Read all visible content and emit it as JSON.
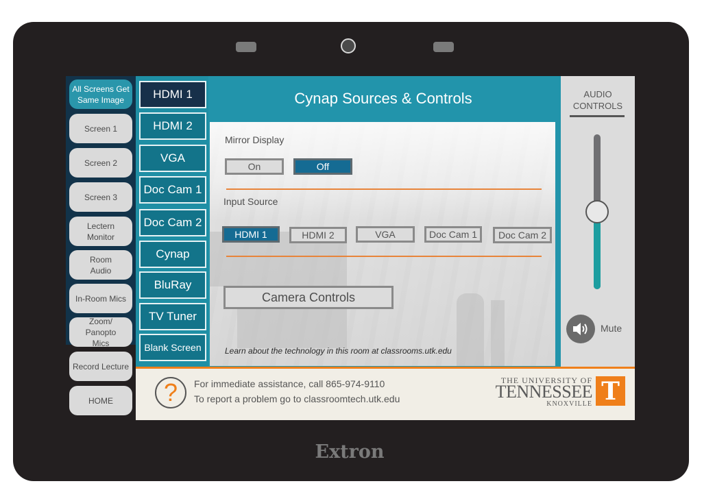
{
  "device": {
    "brand": "Extron"
  },
  "left_nav": {
    "items": [
      {
        "label": "All Screens Get Same Image",
        "active": true
      },
      {
        "label": "Screen 1",
        "active": false
      },
      {
        "label": "Screen 2",
        "active": false
      },
      {
        "label": "Screen 3",
        "active": false
      },
      {
        "label": "Lectern Monitor",
        "active": false
      },
      {
        "label": "Room Audio",
        "active": false
      },
      {
        "label": "In-Room Mics",
        "active": false
      },
      {
        "label": "Zoom/ Panopto Mics",
        "active": false
      },
      {
        "label": "Record Lecture",
        "active": false
      },
      {
        "label": "HOME",
        "active": false
      }
    ]
  },
  "sources": {
    "items": [
      {
        "label": "HDMI 1",
        "active": true
      },
      {
        "label": "HDMI 2",
        "active": false
      },
      {
        "label": "VGA",
        "active": false
      },
      {
        "label": "Doc Cam 1",
        "active": false
      },
      {
        "label": "Doc Cam 2",
        "active": false
      },
      {
        "label": "Cynap",
        "active": false
      },
      {
        "label": "BluRay",
        "active": false
      },
      {
        "label": "TV Tuner",
        "active": false
      },
      {
        "label": "Blank Screen",
        "active": false
      }
    ]
  },
  "main": {
    "title": "Cynap Sources & Controls",
    "mirror_display": {
      "label": "Mirror Display",
      "options": [
        {
          "label": "On",
          "active": false
        },
        {
          "label": "Off",
          "active": true
        }
      ]
    },
    "input_source": {
      "label": "Input Source",
      "options": [
        {
          "label": "HDMI 1",
          "active": true
        },
        {
          "label": "HDMI 2",
          "active": false
        },
        {
          "label": "VGA",
          "active": false
        },
        {
          "label": "Doc Cam 1",
          "active": false
        },
        {
          "label": "Doc Cam 2",
          "active": false
        }
      ]
    },
    "camera_controls_label": "Camera Controls",
    "learn_text": "Learn about the technology in this room at classrooms.utk.edu"
  },
  "audio": {
    "title_line1": "AUDIO",
    "title_line2": "CONTROLS",
    "volume_fraction": 0.5,
    "mute_label": "Mute",
    "mute_icon": "speaker-icon"
  },
  "footer": {
    "help_icon": "?",
    "line1": "For immediate assistance, call 865-974-9110",
    "line2": "To report a problem go to classroomtech.utk.edu",
    "logo": {
      "line1": "THE UNIVERSITY OF",
      "line2": "TENNESSEE",
      "line3": "KNOXVILLE",
      "mark": "T"
    }
  },
  "colors": {
    "accent_teal": "#2294ab",
    "active_source": "#17304a",
    "source_button": "#13748a",
    "orange": "#ef7f1a",
    "volume_fill": "#1d9ea0"
  }
}
